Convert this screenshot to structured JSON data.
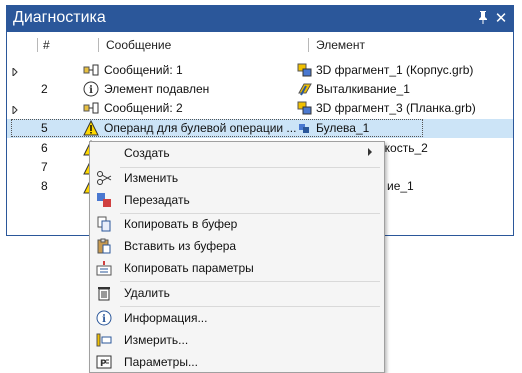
{
  "panel": {
    "title": "Диагностика",
    "pin_icon": "pin-icon",
    "close_icon": "close-icon"
  },
  "columns": {
    "num": "#",
    "message": "Сообщение",
    "element": "Элемент"
  },
  "rows": [
    {
      "num": "",
      "message": "Сообщений: 1",
      "element": "3D фрагмент_1 (Корпус.grb)",
      "expander": true
    },
    {
      "num": "2",
      "message": "Элемент подавлен",
      "element": "Выталкивание_1",
      "expander": false
    },
    {
      "num": "",
      "message": "Сообщений: 2",
      "element": "3D фрагмент_3 (Планка.grb)",
      "expander": true
    },
    {
      "num": "5",
      "message": "Операнд для булевой операции ...",
      "element": "Булева_1",
      "expander": false
    },
    {
      "num": "6",
      "message": "",
      "element": "оскость_2",
      "expander": false
    },
    {
      "num": "7",
      "message": "",
      "element": "",
      "expander": false
    },
    {
      "num": "8",
      "message": "",
      "element": "ие_1",
      "expander": false
    }
  ],
  "context_menu": {
    "create": "Создать",
    "edit": "Изменить",
    "reassign": "Перезадать",
    "copy": "Копировать в буфер",
    "paste": "Вставить из буфера",
    "copy_params": "Копировать параметры",
    "delete": "Удалить",
    "info": "Информация...",
    "measure": "Измерить...",
    "params": "Параметры..."
  },
  "colors": {
    "accent": "#2b579a",
    "selection": "#cce4f7",
    "warning": "#ffd800"
  }
}
